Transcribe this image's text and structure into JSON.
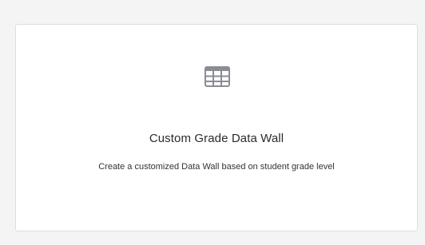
{
  "card": {
    "title": "Custom Grade Data Wall",
    "description": "Create a customized Data Wall based on student grade level",
    "icon": "grid-table-icon",
    "icon_color": "#8a8d96"
  }
}
